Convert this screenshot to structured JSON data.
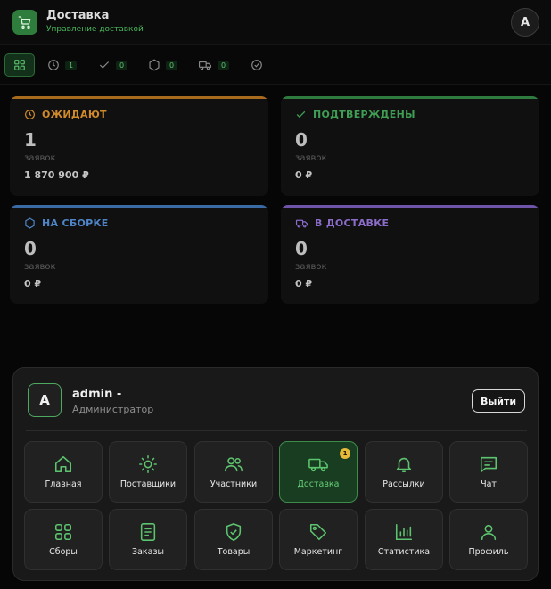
{
  "header": {
    "title": "Доставка",
    "subtitle": "Управление доставкой",
    "avatar_letter": "A"
  },
  "filter_tabs": [
    {
      "icon": "grid-icon",
      "count": "",
      "active": true
    },
    {
      "icon": "clock-icon",
      "count": "1"
    },
    {
      "icon": "check-icon",
      "count": "0"
    },
    {
      "icon": "hexagon-icon",
      "count": "0"
    },
    {
      "icon": "truck-icon",
      "count": "0"
    },
    {
      "icon": "check-circle-icon",
      "count": ""
    }
  ],
  "status_cards": [
    {
      "id": "pending",
      "title": "ОЖИДАЮТ",
      "count": "1",
      "unit": "заявок",
      "amount": "1 870 900 ₽",
      "color": "#d08a2a",
      "icon": "clock-icon"
    },
    {
      "id": "confirmed",
      "title": "ПОДТВЕРЖДЕНЫ",
      "count": "0",
      "unit": "заявок",
      "amount": "0 ₽",
      "color": "#3f9d54",
      "icon": "check-icon"
    },
    {
      "id": "assembly",
      "title": "НА СБОРКЕ",
      "count": "0",
      "unit": "заявок",
      "amount": "0 ₽",
      "color": "#4e86c9",
      "icon": "hexagon-icon"
    },
    {
      "id": "delivery",
      "title": "В ДОСТАВКЕ",
      "count": "0",
      "unit": "заявок",
      "amount": "0 ₽",
      "color": "#8a6cc9",
      "icon": "truck-icon"
    }
  ],
  "user_panel": {
    "avatar_letter": "A",
    "name": "admin -",
    "role": "Администратор",
    "logout_label": "Выйти"
  },
  "nav_items": [
    {
      "id": "home",
      "label": "Главная",
      "icon": "home-icon"
    },
    {
      "id": "suppliers",
      "label": "Поставщики",
      "icon": "sun-icon"
    },
    {
      "id": "members",
      "label": "Участники",
      "icon": "users-icon"
    },
    {
      "id": "delivery",
      "label": "Доставка",
      "icon": "truck-icon",
      "active": true,
      "badge": "1"
    },
    {
      "id": "mailings",
      "label": "Рассылки",
      "icon": "bell-icon"
    },
    {
      "id": "chat",
      "label": "Чат",
      "icon": "chat-icon"
    },
    {
      "id": "collections",
      "label": "Сборы",
      "icon": "grid-icon"
    },
    {
      "id": "orders",
      "label": "Заказы",
      "icon": "document-icon"
    },
    {
      "id": "products",
      "label": "Товары",
      "icon": "shield-check-icon"
    },
    {
      "id": "marketing",
      "label": "Маркетинг",
      "icon": "tag-icon"
    },
    {
      "id": "statistics",
      "label": "Статистика",
      "icon": "bar-chart-icon"
    },
    {
      "id": "profile",
      "label": "Профиль",
      "icon": "user-icon"
    }
  ],
  "colors": {
    "accent": "#4ea860",
    "badge": "#e6b93a",
    "background": "#060606"
  }
}
